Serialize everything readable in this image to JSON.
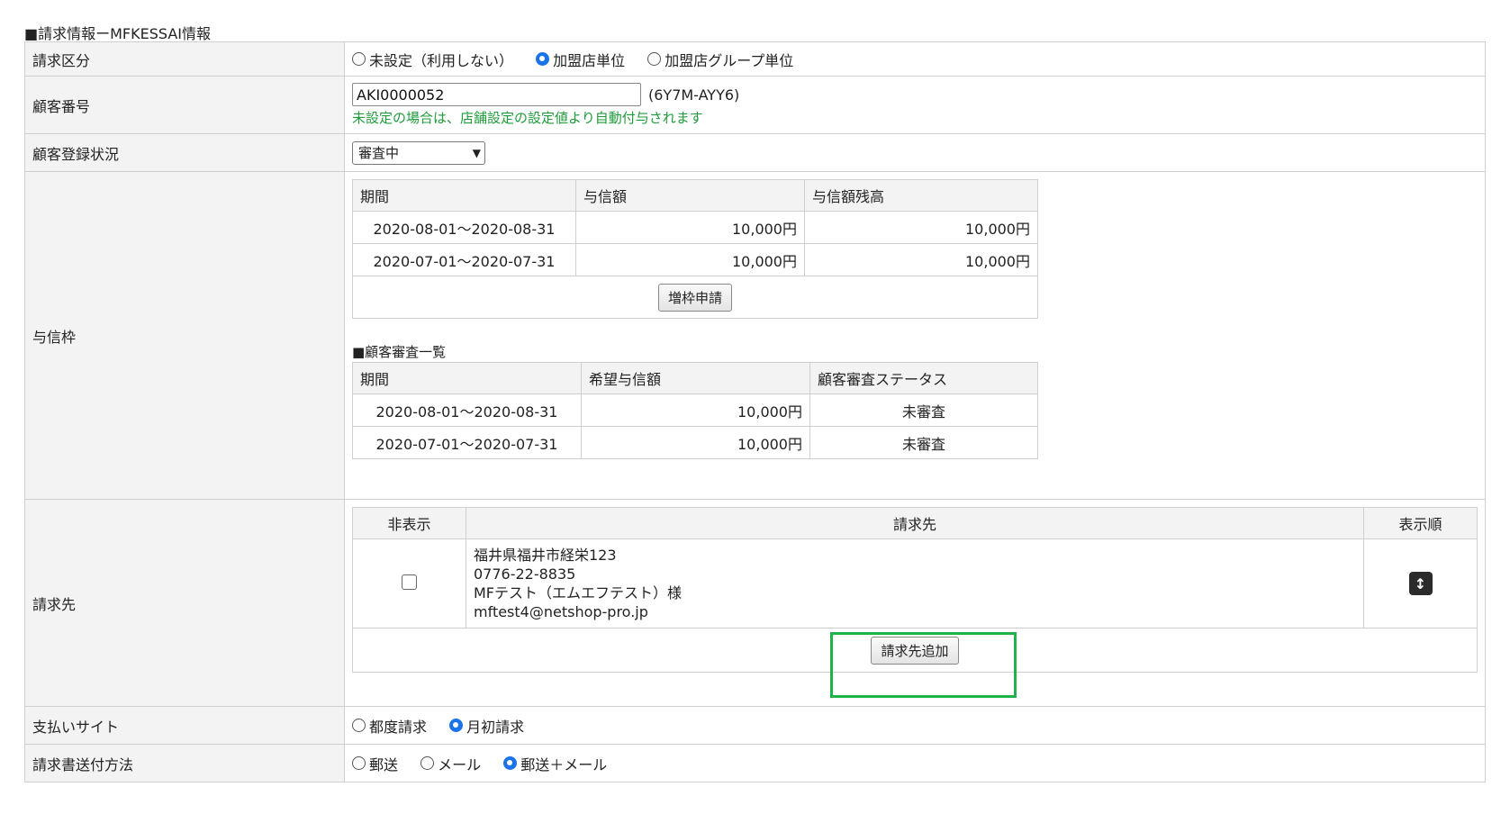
{
  "section_title": "■請求情報ーMFKESSAI情報",
  "billing_type": {
    "label": "請求区分",
    "options": [
      {
        "label": "未設定（利用しない）",
        "selected": false
      },
      {
        "label": "加盟店単位",
        "selected": true
      },
      {
        "label": "加盟店グループ単位",
        "selected": false
      }
    ]
  },
  "customer_number": {
    "label": "顧客番号",
    "value": "AKI0000052",
    "code": "(6Y7M-AYY6)",
    "hint": "未設定の場合は、店舗設定の設定値より自動付与されます"
  },
  "registration_status": {
    "label": "顧客登録状況",
    "selected": "審査中"
  },
  "credit_limit": {
    "label": "与信枠",
    "headers": [
      "期間",
      "与信額",
      "与信額残高"
    ],
    "rows": [
      [
        "2020-08-01〜2020-08-31",
        "10,000円",
        "10,000円"
      ],
      [
        "2020-07-01〜2020-07-31",
        "10,000円",
        "10,000円"
      ]
    ],
    "increase_button": "増枠申請",
    "review_title": "■顧客審査一覧",
    "review_headers": [
      "期間",
      "希望与信額",
      "顧客審査ステータス"
    ],
    "review_rows": [
      [
        "2020-08-01〜2020-08-31",
        "10,000円",
        "未審査"
      ],
      [
        "2020-07-01〜2020-07-31",
        "10,000円",
        "未審査"
      ]
    ]
  },
  "billing_destination": {
    "label": "請求先",
    "headers": [
      "非表示",
      "請求先",
      "表示順"
    ],
    "address": {
      "line1": "福井県福井市経栄123",
      "phone": "0776-22-8835",
      "name": "MFテスト（エムエフテスト）様",
      "email": "mftest4@netshop-pro.jp"
    },
    "add_button": "請求先追加",
    "sort_icon": "arrow-up-down-icon",
    "highlight_color": "#1fb24a"
  },
  "payment_site": {
    "label": "支払いサイト",
    "options": [
      {
        "label": "都度請求",
        "selected": false
      },
      {
        "label": "月初請求",
        "selected": true
      }
    ]
  },
  "delivery_method": {
    "label": "請求書送付方法",
    "options": [
      {
        "label": "郵送",
        "selected": false
      },
      {
        "label": "メール",
        "selected": false
      },
      {
        "label": "郵送＋メール",
        "selected": true
      }
    ]
  }
}
